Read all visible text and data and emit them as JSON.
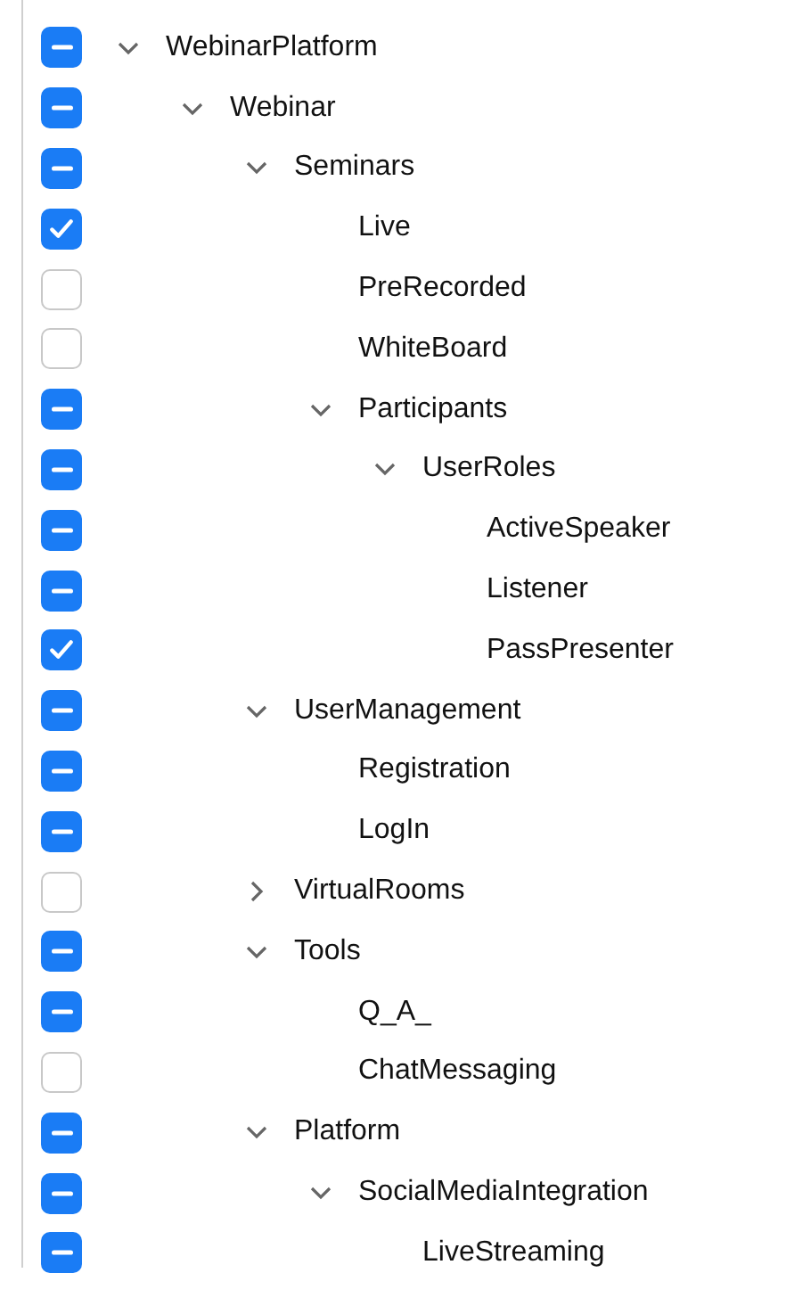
{
  "tree": [
    {
      "label": "WebinarPlatform",
      "checked": true,
      "indeterminate": true,
      "expanded": true,
      "children": [
        {
          "label": "Webinar",
          "checked": true,
          "indeterminate": true,
          "expanded": true,
          "children": [
            {
              "label": "Seminars",
              "checked": true,
              "indeterminate": true,
              "expanded": true,
              "children": [
                {
                  "label": "Live",
                  "checked": true,
                  "indeterminate": false
                },
                {
                  "label": "PreRecorded",
                  "checked": false,
                  "indeterminate": false
                },
                {
                  "label": "WhiteBoard",
                  "checked": false,
                  "indeterminate": false
                },
                {
                  "label": "Participants",
                  "checked": true,
                  "indeterminate": true,
                  "expanded": true,
                  "children": [
                    {
                      "label": "UserRoles",
                      "checked": true,
                      "indeterminate": true,
                      "expanded": true,
                      "children": [
                        {
                          "label": "ActiveSpeaker",
                          "checked": true,
                          "indeterminate": true
                        },
                        {
                          "label": "Listener",
                          "checked": true,
                          "indeterminate": true
                        },
                        {
                          "label": "PassPresenter",
                          "checked": true,
                          "indeterminate": false
                        }
                      ]
                    }
                  ]
                }
              ]
            },
            {
              "label": "UserManagement",
              "checked": true,
              "indeterminate": true,
              "expanded": true,
              "children": [
                {
                  "label": "Registration",
                  "checked": true,
                  "indeterminate": true
                },
                {
                  "label": "LogIn",
                  "checked": true,
                  "indeterminate": true
                }
              ]
            },
            {
              "label": "VirtualRooms",
              "checked": false,
              "indeterminate": false,
              "expanded": false
            },
            {
              "label": "Tools",
              "checked": true,
              "indeterminate": true,
              "expanded": true,
              "children": [
                {
                  "label": "Q_A_",
                  "checked": true,
                  "indeterminate": true
                },
                {
                  "label": "ChatMessaging",
                  "checked": false,
                  "indeterminate": false
                }
              ]
            },
            {
              "label": "Platform",
              "checked": true,
              "indeterminate": true,
              "expanded": true,
              "children": [
                {
                  "label": "SocialMediaIntegration",
                  "checked": true,
                  "indeterminate": true,
                  "expanded": true,
                  "children": [
                    {
                      "label": "LiveStreaming",
                      "checked": true,
                      "indeterminate": true
                    }
                  ]
                }
              ]
            }
          ]
        }
      ]
    }
  ]
}
